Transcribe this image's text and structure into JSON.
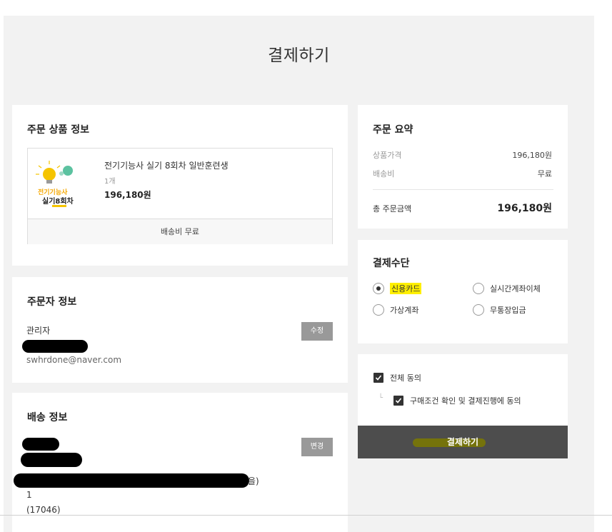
{
  "page": {
    "title": "결제하기"
  },
  "product_section": {
    "heading": "주문 상품 정보",
    "item": {
      "name": "전기기능사 실기 8회차 일반훈련생",
      "qty": "1개",
      "price": "196,180원",
      "thumb_line1": "전기기능사",
      "thumb_line2": "실기8회차"
    },
    "shipping": "배송비 무료"
  },
  "orderer_section": {
    "heading": "주문자 정보",
    "name": "관리자",
    "email": "swhrdone@naver.com",
    "edit_label": "수정"
  },
  "delivery_section": {
    "heading": "배송 정보",
    "change_label": "변경",
    "addr_suffix": "을)",
    "addr_line2": "1",
    "postal": "(17046)"
  },
  "summary_section": {
    "heading": "주문 요약",
    "product_price_label": "상품가격",
    "product_price": "196,180원",
    "shipping_label": "배송비",
    "shipping_value": "무료",
    "total_label": "총 주문금액",
    "total_value": "196,180원"
  },
  "payment_section": {
    "heading": "결제수단",
    "methods": [
      {
        "label": "신용카드",
        "selected": true
      },
      {
        "label": "실시간계좌이체",
        "selected": false
      },
      {
        "label": "가상계좌",
        "selected": false
      },
      {
        "label": "무통장입금",
        "selected": false
      }
    ]
  },
  "agreement_section": {
    "all_label": "전체 동의",
    "sub_label": "구매조건 확인 및 결제진행에 동의",
    "tree_mark": "└"
  },
  "pay_button": {
    "label": "결제하기"
  },
  "colors": {
    "highlight": "#ffef00",
    "button_dark": "#4d4d4d",
    "panel_bg": "#f2f2f2"
  }
}
